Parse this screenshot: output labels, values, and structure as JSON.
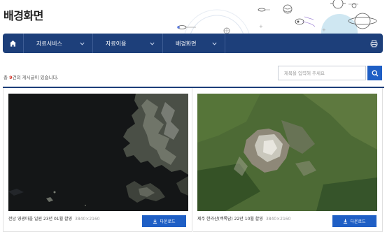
{
  "page": {
    "title": "배경화면"
  },
  "nav": {
    "home_icon": "home-icon",
    "items": [
      {
        "label": "자료서비스"
      },
      {
        "label": "자료이용"
      },
      {
        "label": "배경화면"
      }
    ],
    "print_icon": "print-icon",
    "colors": {
      "background": "#1d3f7a",
      "accent": "#1f5fc5"
    }
  },
  "list": {
    "count_prefix": "총",
    "count_value": "9",
    "count_suffix": "건의 게시글이 있습니다."
  },
  "search": {
    "placeholder": "제목을 입력해 주세요",
    "value": "",
    "button_icon": "search-icon"
  },
  "cards": [
    {
      "title": "전남 영광마을 일원 23년 01월 촬영",
      "resolution": "3840×2160",
      "button_label": "다운로드"
    },
    {
      "title": "제주 한라산(백록담) 22년 10월 촬영",
      "resolution": "3840×2160",
      "button_label": "다운로드"
    }
  ]
}
